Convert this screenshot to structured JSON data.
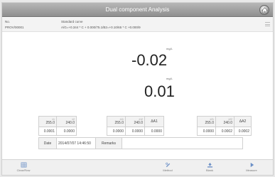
{
  "window": {
    "title": "Dual component Analysis"
  },
  "info": {
    "no_label": "No.",
    "no_value": "PROV/00001",
    "curve_label": "Standard curve",
    "curve_value": "A/G=+0.344 * C + 0.000/75.1/B2=+0.10/65 * C +0.000/9"
  },
  "results": {
    "value1": "-0.02",
    "unit1": "mg/L",
    "value2": "0.01",
    "unit2": "mg/L"
  },
  "measurement_table": {
    "header": [
      {
        "top": "λ1",
        "bottom": "255.0"
      },
      {
        "top": "λ2",
        "bottom": "240.0"
      },
      {
        "top": "λ11",
        "bottom": "255.0"
      },
      {
        "top": "λ12",
        "bottom": "240.0"
      },
      {
        "top": "",
        "bottom": "ΔA1"
      },
      {
        "top": "λ21",
        "bottom": "255.0"
      },
      {
        "top": "λ22",
        "bottom": "240.0"
      },
      {
        "top": "",
        "bottom": "ΔA2"
      }
    ],
    "values": [
      "0.0001",
      "0.0000",
      "0.0000",
      "0.0000",
      "0.0000",
      "0.0000",
      "0.0002",
      "0.0002"
    ]
  },
  "remarks_row": {
    "date_label": "Date",
    "date_value": "2014/07/07 14:46:50",
    "remarks_label": "Remarks",
    "remarks_value": ""
  },
  "bottom_bar": {
    "clear_label": "Clear/Row",
    "method_label": "Method",
    "blank_label": "Blank",
    "measure_label": "Measure"
  }
}
